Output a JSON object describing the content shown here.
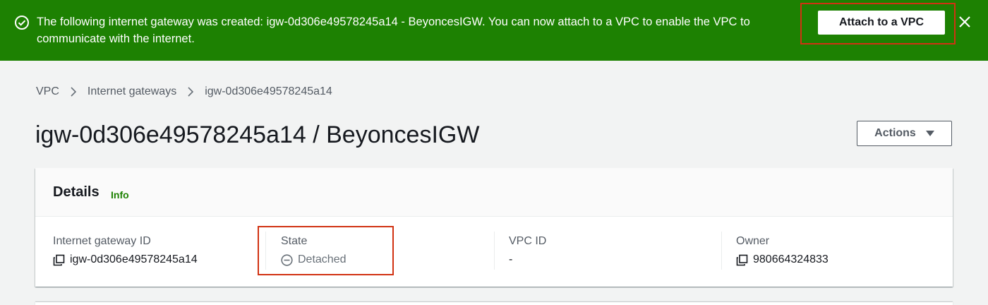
{
  "flash": {
    "message": "The following internet gateway was created: igw-0d306e49578245a14 - BeyoncesIGW. You can now attach to a VPC to enable the VPC to communicate with the internet.",
    "action_label": "Attach to a VPC",
    "icon": "check-circle-icon",
    "close_icon": "close-icon",
    "color": "#1d8102"
  },
  "breadcrumb": {
    "items": [
      "VPC",
      "Internet gateways",
      "igw-0d306e49578245a14"
    ]
  },
  "page": {
    "title": "igw-0d306e49578245a14 / BeyoncesIGW",
    "actions_label": "Actions"
  },
  "details": {
    "title": "Details",
    "info_label": "Info",
    "fields": [
      {
        "label": "Internet gateway ID",
        "value": "igw-0d306e49578245a14",
        "icon": "copy-icon"
      },
      {
        "label": "State",
        "value": "Detached",
        "icon": "minus-circle-icon"
      },
      {
        "label": "VPC ID",
        "value": "-"
      },
      {
        "label": "Owner",
        "value": "980664324833",
        "icon": "copy-icon"
      }
    ]
  },
  "colors": {
    "highlight": "#d13212",
    "success": "#1d8102"
  }
}
